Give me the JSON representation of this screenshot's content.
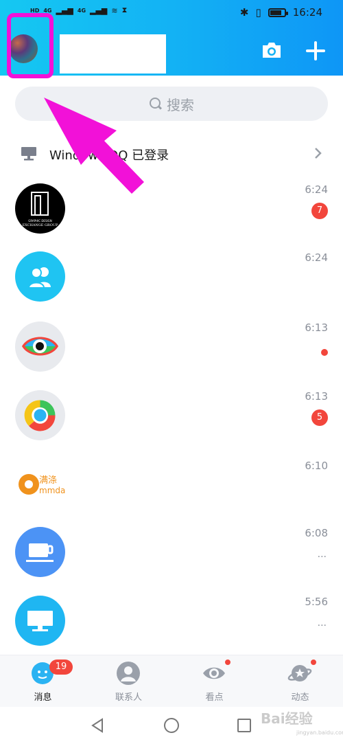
{
  "status_bar": {
    "left_label": "HD",
    "network_1": "4G",
    "network_2": "4G",
    "time": "16:24"
  },
  "header": {
    "name_char": "?"
  },
  "search": {
    "placeholder": "搜索"
  },
  "pc_login": {
    "text": "Windows QQ 已登录"
  },
  "conversations": [
    {
      "time": "6:24",
      "badge": "7"
    },
    {
      "time": "6:24",
      "badge": ""
    },
    {
      "time": "6:13",
      "badge": ""
    },
    {
      "time": "6:13",
      "badge": "5"
    },
    {
      "time": "6:10",
      "badge": ""
    },
    {
      "time": "6:08",
      "badge": "..."
    },
    {
      "time": "5:56",
      "badge": "..."
    }
  ],
  "tabs": [
    {
      "label": "消息",
      "badge": "19"
    },
    {
      "label": "联系人"
    },
    {
      "label": "看点"
    },
    {
      "label": "动态"
    }
  ],
  "avatar_texts": {
    "logo_line1": "GRAPHIC DESIGN",
    "logo_line2": "EXCHANGE GROUP",
    "mmd_line1": "满涤",
    "mmd_line2": "mmda"
  },
  "watermark": {
    "main": "Bai经验",
    "sub": "jingyan.baidu.com"
  },
  "colors": {
    "header_start": "#15c8f2",
    "header_end": "#0e96f6",
    "highlight": "#f211d8",
    "badge": "#f2463c"
  }
}
